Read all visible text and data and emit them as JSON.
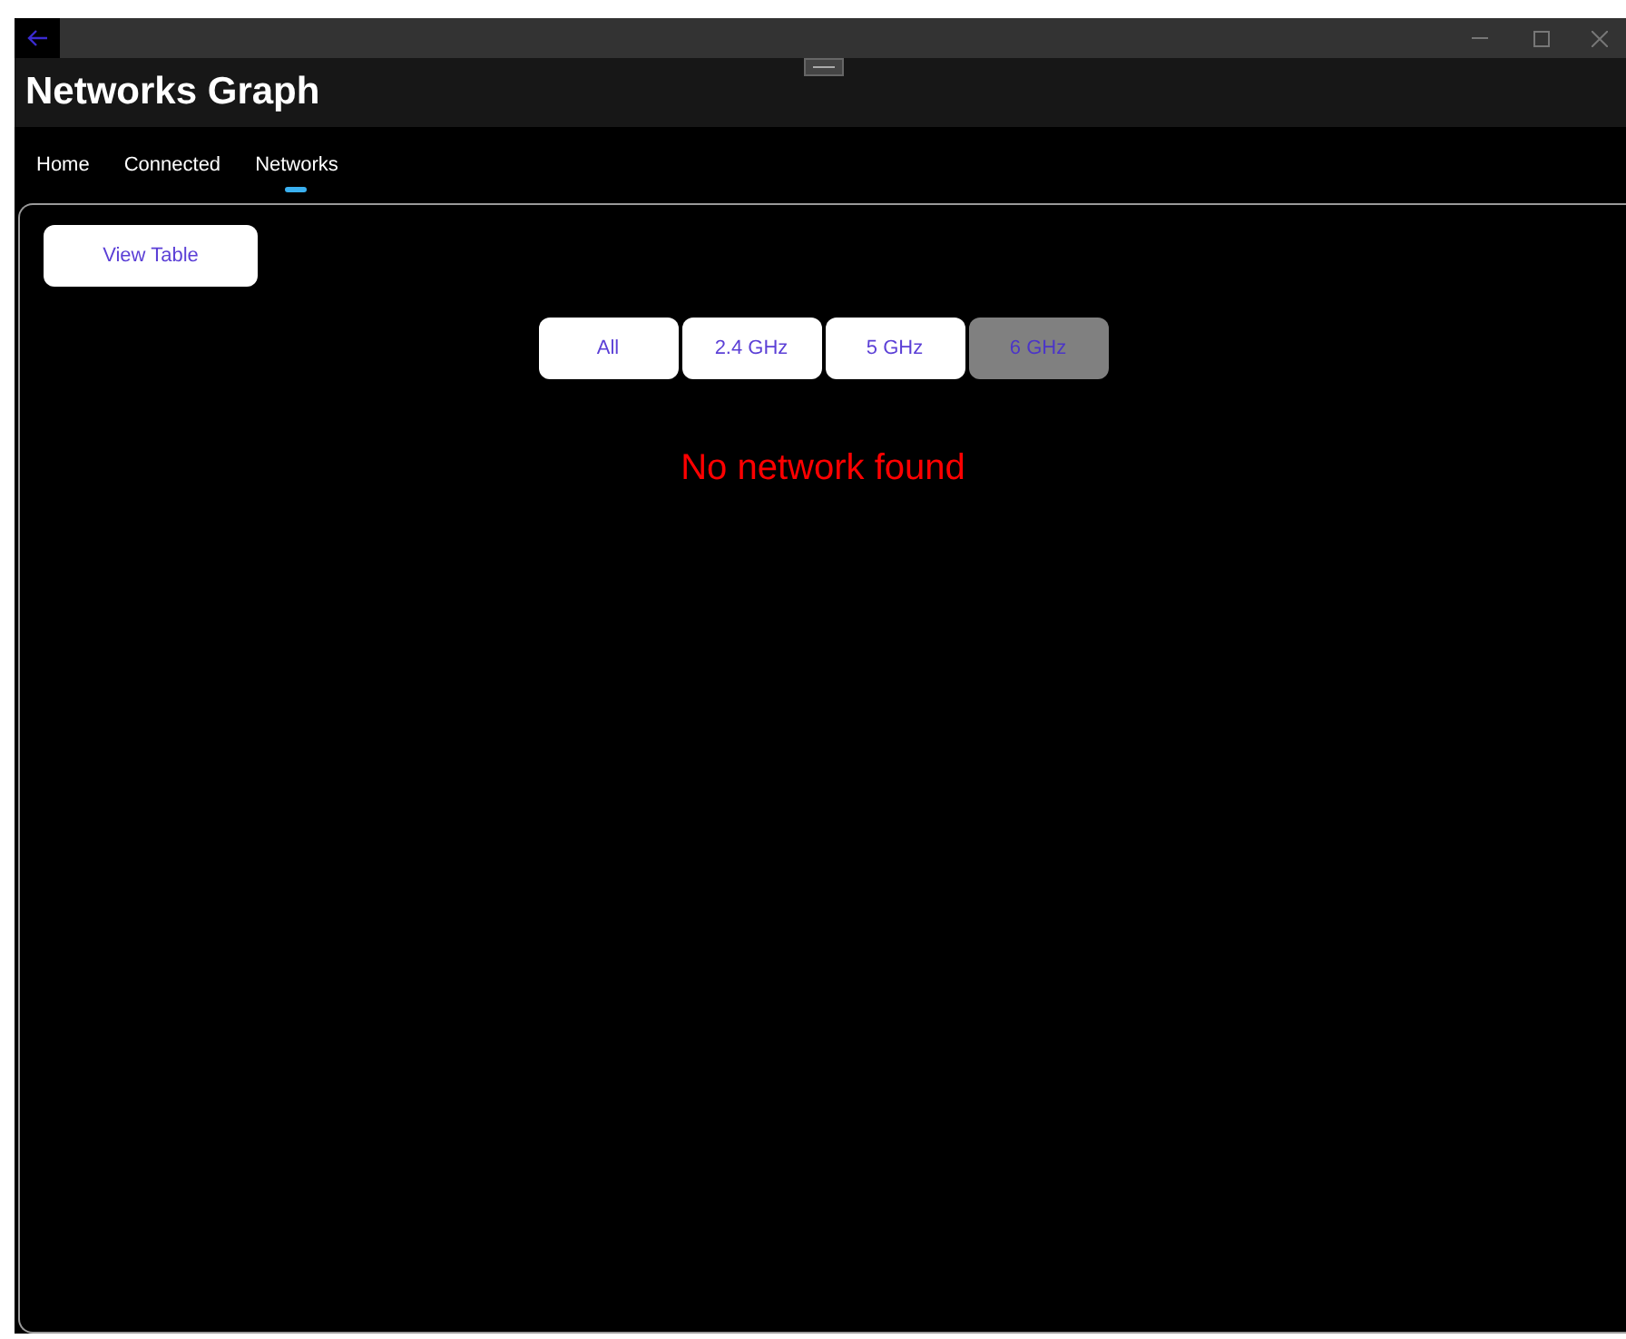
{
  "window": {
    "title": "Networks Graph"
  },
  "tabs": [
    {
      "label": "Home",
      "selected": false
    },
    {
      "label": "Connected",
      "selected": false
    },
    {
      "label": "Networks",
      "selected": true
    }
  ],
  "view_button": "View Table",
  "filters": [
    {
      "label": "All",
      "selected": false
    },
    {
      "label": "2.4 GHz",
      "selected": false
    },
    {
      "label": "5 GHz",
      "selected": false
    },
    {
      "label": "6 GHz",
      "selected": true
    }
  ],
  "message": "No network found"
}
